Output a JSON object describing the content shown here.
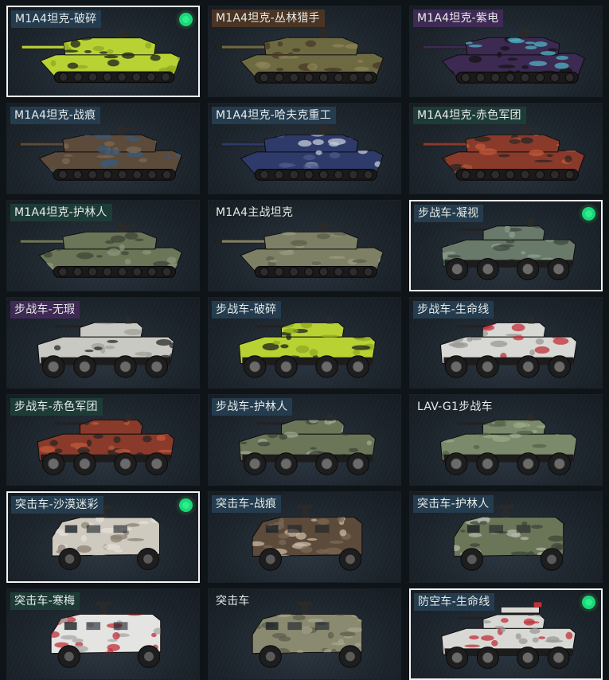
{
  "skins": [
    {
      "name": "M1A4坦克-破碎",
      "rarity": "blue",
      "kind": "tank",
      "colors": [
        "#b8d234",
        "#1b1f1c",
        "#8eaa22"
      ],
      "selected": true,
      "equipped": true
    },
    {
      "name": "M1A4坦克-丛林猎手",
      "rarity": "gold",
      "kind": "tank",
      "colors": [
        "#6d6a42",
        "#4a3a28",
        "#8c8457"
      ],
      "selected": false,
      "equipped": false
    },
    {
      "name": "M1A4坦克-紫电",
      "rarity": "purple",
      "kind": "tank",
      "colors": [
        "#3c2a52",
        "#151418",
        "#4fb3c4"
      ],
      "selected": false,
      "equipped": false
    },
    {
      "name": "M1A4坦克-战痕",
      "rarity": "blue",
      "kind": "tank",
      "colors": [
        "#5c4a3a",
        "#7b6a55",
        "#3a5a7a"
      ],
      "selected": false,
      "equipped": false
    },
    {
      "name": "M1A4坦克-哈夫克重工",
      "rarity": "blue",
      "kind": "tank",
      "colors": [
        "#2d3a6a",
        "#c4ccd8",
        "#4a5a8a"
      ],
      "selected": false,
      "equipped": false
    },
    {
      "name": "M1A4坦克-赤色军团",
      "rarity": "green",
      "kind": "tank",
      "colors": [
        "#8a3a2a",
        "#2a2624",
        "#c05a3a"
      ],
      "selected": false,
      "equipped": false
    },
    {
      "name": "M1A4坦克-护林人",
      "rarity": "green",
      "kind": "tank",
      "colors": [
        "#6b7558",
        "#3e4638",
        "#8a9478"
      ],
      "selected": false,
      "equipped": false
    },
    {
      "name": "M1A4主战坦克",
      "rarity": "none",
      "kind": "tank",
      "colors": [
        "#7e8066",
        "#5c5f4a",
        "#9a9a80"
      ],
      "selected": false,
      "equipped": false
    },
    {
      "name": "步战车-凝视",
      "rarity": "blue",
      "kind": "ifv",
      "colors": [
        "#6a7a6a",
        "#3e4a40",
        "#8aa090"
      ],
      "selected": true,
      "equipped": true
    },
    {
      "name": "步战车-无瑕",
      "rarity": "purple",
      "kind": "ifv",
      "colors": [
        "#c9c9c4",
        "#2a2a2a",
        "#a0a09a"
      ],
      "selected": false,
      "equipped": false
    },
    {
      "name": "步战车-破碎",
      "rarity": "blue",
      "kind": "ifv",
      "colors": [
        "#b8d234",
        "#1b1f1c",
        "#8eaa22"
      ],
      "selected": false,
      "equipped": false
    },
    {
      "name": "步战车-生命线",
      "rarity": "blue",
      "kind": "ifv",
      "colors": [
        "#d8d8d4",
        "#c0303a",
        "#9a9a96"
      ],
      "selected": false,
      "equipped": false
    },
    {
      "name": "步战车-赤色军团",
      "rarity": "green",
      "kind": "ifv",
      "colors": [
        "#8a3a2a",
        "#2a2624",
        "#c05a3a"
      ],
      "selected": false,
      "equipped": false
    },
    {
      "name": "步战车-护林人",
      "rarity": "blue",
      "kind": "ifv",
      "colors": [
        "#6b7558",
        "#3e4638",
        "#a0a890"
      ],
      "selected": false,
      "equipped": false
    },
    {
      "name": "LAV-G1步战车",
      "rarity": "none",
      "kind": "ifv",
      "colors": [
        "#7a8a6a",
        "#55604a",
        "#9aa888"
      ],
      "selected": false,
      "equipped": false
    },
    {
      "name": "突击车-沙漠迷彩",
      "rarity": "blue",
      "kind": "mrap",
      "colors": [
        "#cfcac0",
        "#8a8070",
        "#e4e0d8"
      ],
      "selected": true,
      "equipped": true
    },
    {
      "name": "突击车-战痕",
      "rarity": "blue",
      "kind": "mrap",
      "colors": [
        "#5c4a3a",
        "#7b6a55",
        "#c8b8a0"
      ],
      "selected": false,
      "equipped": false
    },
    {
      "name": "突击车-护林人",
      "rarity": "blue",
      "kind": "mrap",
      "colors": [
        "#6b7558",
        "#3e4638",
        "#b4b8a8"
      ],
      "selected": false,
      "equipped": false
    },
    {
      "name": "突击车-寒梅",
      "rarity": "green",
      "kind": "mrap",
      "colors": [
        "#e4e4e2",
        "#a8a8a6",
        "#c0303a"
      ],
      "selected": false,
      "equipped": false
    },
    {
      "name": "突击车",
      "rarity": "none",
      "kind": "mrap",
      "colors": [
        "#8a8a70",
        "#5c5e4c",
        "#a4a48c"
      ],
      "selected": false,
      "equipped": false
    },
    {
      "name": "防空车-生命线",
      "rarity": "blue",
      "kind": "aa",
      "colors": [
        "#d8d8d4",
        "#c0303a",
        "#9a9a96"
      ],
      "selected": true,
      "equipped": true
    }
  ]
}
